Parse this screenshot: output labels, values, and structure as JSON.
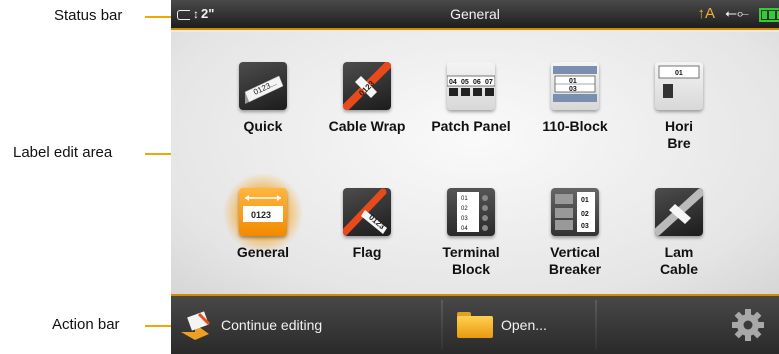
{
  "callouts": {
    "status_bar": "Status bar",
    "label_edit_area": "Label edit area",
    "action_bar": "Action bar"
  },
  "status_bar": {
    "tape_size": "2\"",
    "title": "General",
    "icons": [
      "tape-cartridge-icon",
      "text-direction-icon",
      "usb-icon",
      "battery-icon"
    ]
  },
  "label_types": [
    {
      "label": "Quick",
      "icon": "quick-label-icon"
    },
    {
      "label": "Cable Wrap",
      "icon": "cable-wrap-icon"
    },
    {
      "label": "Patch Panel",
      "icon": "patch-panel-icon"
    },
    {
      "label": "110-Block",
      "icon": "110-block-icon"
    },
    {
      "label": "Hori\nBre",
      "icon": "horizontal-breaker-icon"
    },
    {
      "label": "General",
      "icon": "general-label-icon",
      "selected": true
    },
    {
      "label": "Flag",
      "icon": "flag-icon"
    },
    {
      "label": "Terminal\nBlock",
      "icon": "terminal-block-icon"
    },
    {
      "label": "Vertical\nBreaker",
      "icon": "vertical-breaker-icon"
    },
    {
      "label": "Lam\nCable",
      "icon": "laminated-cable-icon"
    }
  ],
  "icon_text": {
    "quick": "0123...",
    "cable_wrap": "0123",
    "patch_panel": [
      "04",
      "05",
      "06",
      "07"
    ],
    "block110": [
      "01",
      "03"
    ],
    "horizontal_breaker": "01",
    "general": "0123",
    "flag": "0123",
    "terminal_block": [
      "01",
      "02",
      "03",
      "04"
    ],
    "vertical_breaker": [
      "01",
      "02",
      "03"
    ]
  },
  "action_bar": {
    "continue_label": "Continue editing",
    "open_label": "Open...",
    "settings_icon": "gear-icon"
  },
  "colors": {
    "accent": "#f2a600",
    "bar_dark": "#2a2a2a",
    "selected_glow": "#f5a014",
    "battery": "#33cc33"
  }
}
